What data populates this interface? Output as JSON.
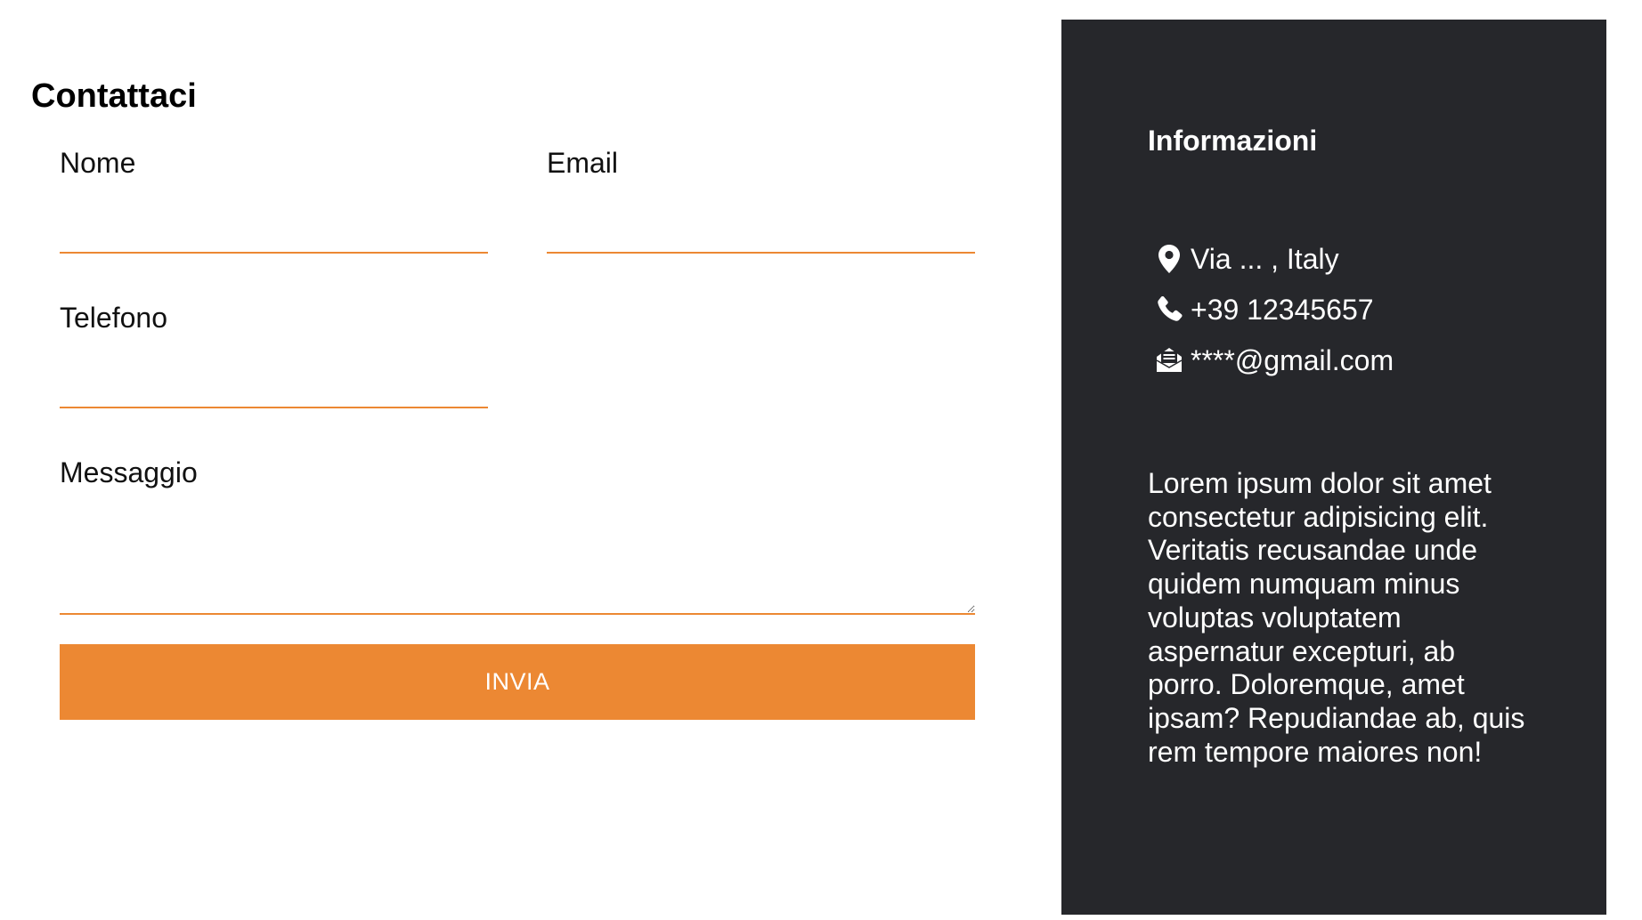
{
  "form": {
    "title": "Contattaci",
    "fields": {
      "nome": {
        "label": "Nome",
        "value": ""
      },
      "email": {
        "label": "Email",
        "value": ""
      },
      "telefono": {
        "label": "Telefono",
        "value": ""
      },
      "messaggio": {
        "label": "Messaggio",
        "value": ""
      }
    },
    "submit_label": "INVIA"
  },
  "info": {
    "title": "Informazioni",
    "items": [
      {
        "icon": "map-pin-icon",
        "text": "Via ... , Italy"
      },
      {
        "icon": "phone-icon",
        "text": "+39 12345657"
      },
      {
        "icon": "envelope-open-icon",
        "text": "****@gmail.com"
      }
    ],
    "description": "Lorem ipsum dolor sit amet consectetur adipisicing elit. Veritatis recusandae unde quidem numquam minus voluptas voluptatem aspernatur excepturi, ab porro. Doloremque, amet ipsam? Repudiandae ab, quis rem tempore maiores non!"
  },
  "colors": {
    "accent": "#ec8833",
    "panel_background": "#26272b",
    "page_background": "#ffffff",
    "panel_text": "#ffffff"
  }
}
